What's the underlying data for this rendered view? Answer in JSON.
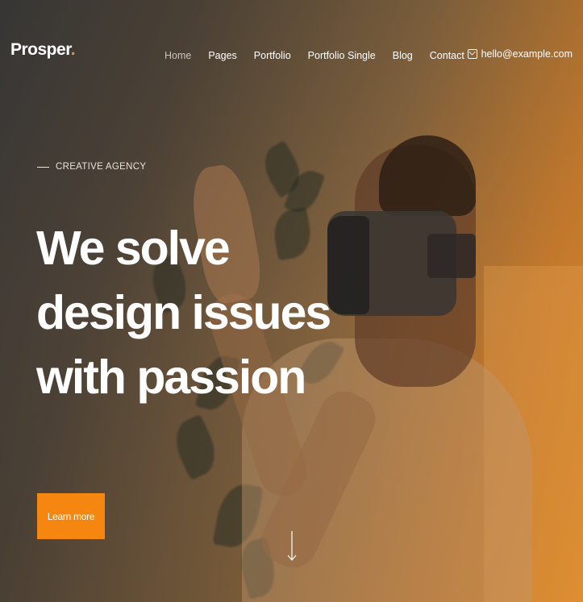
{
  "header": {
    "logo_text": "Prosper",
    "logo_dot": ".",
    "nav": [
      {
        "label": "Home",
        "active": true
      },
      {
        "label": "Pages"
      },
      {
        "label": "Portfolio"
      },
      {
        "label": "Portfolio Single"
      },
      {
        "label": "Blog"
      },
      {
        "label": "Contact"
      }
    ],
    "email": "hello@example.com",
    "email_icon": "mail-icon"
  },
  "hero": {
    "eyebrow": "CREATIVE AGENCY",
    "headline_lines": [
      "We solve",
      "design issues",
      "with passion"
    ],
    "cta_label": "Learn more",
    "scroll_icon": "arrow-down-icon"
  },
  "colors": {
    "accent": "#f58610",
    "text": "#ffffff",
    "nav_active": "#c9c4be"
  }
}
